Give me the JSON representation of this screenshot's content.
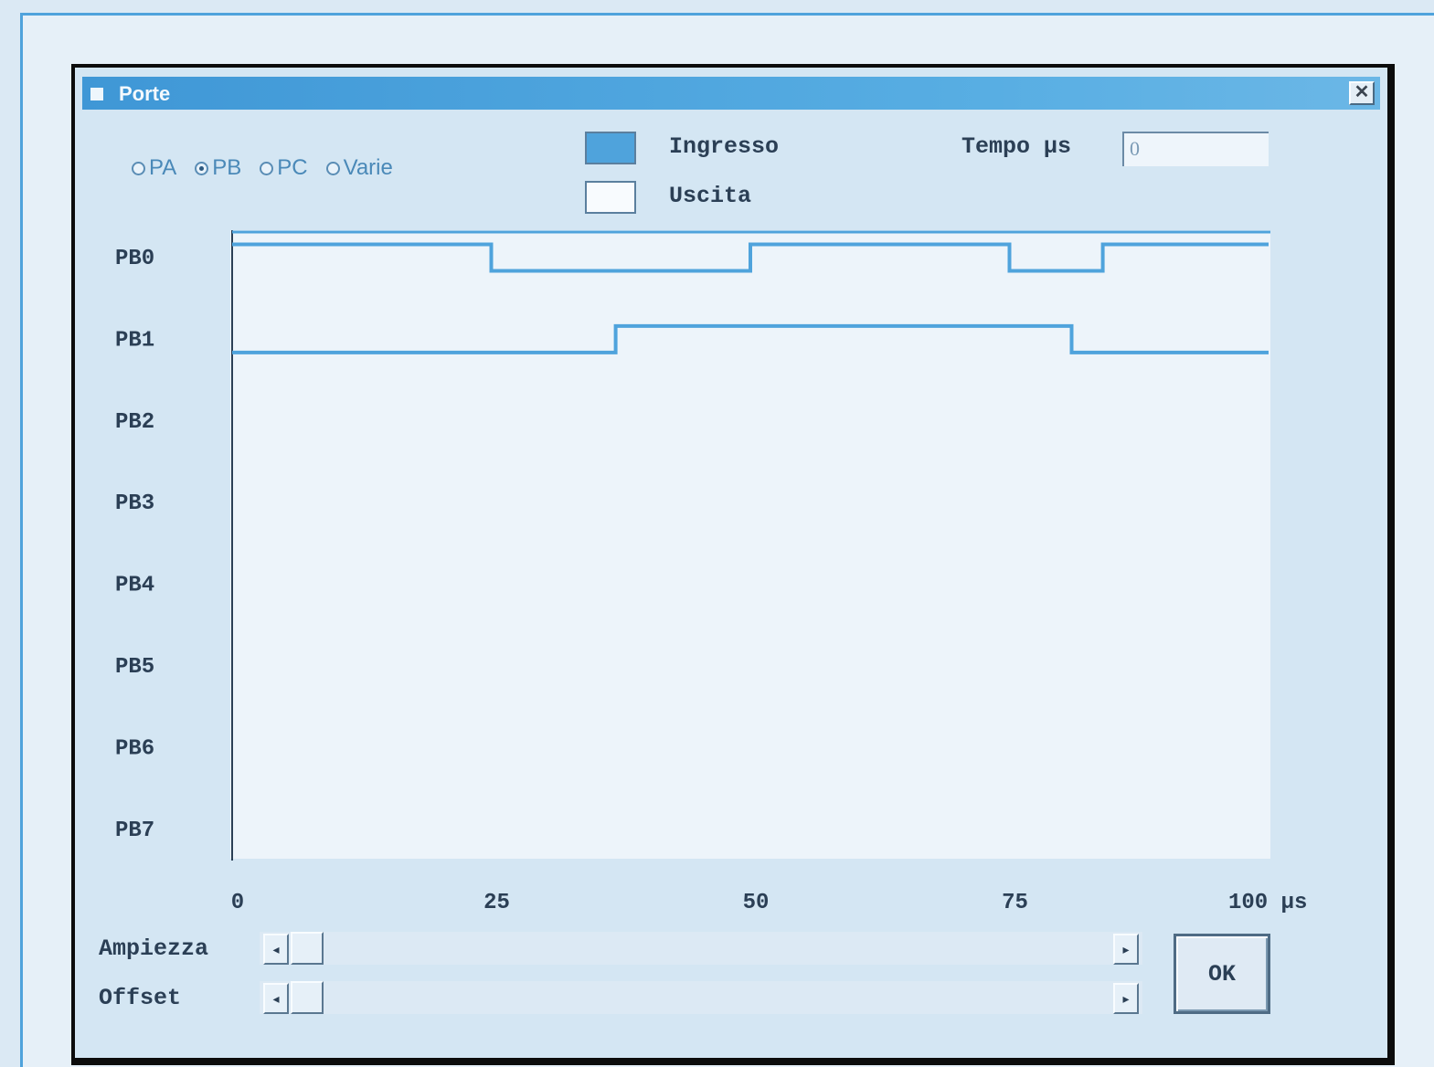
{
  "window": {
    "title": "Porte",
    "close_glyph": "✕"
  },
  "ports": [
    {
      "label": "PA",
      "selected": false
    },
    {
      "label": "PB",
      "selected": true
    },
    {
      "label": "PC",
      "selected": false
    },
    {
      "label": "Varie",
      "selected": false
    }
  ],
  "legend": {
    "input_label": "Ingresso",
    "output_label": "Uscita",
    "input_color": "#4fa3dc",
    "output_color": "#f8fbfe"
  },
  "tempo": {
    "label": "Tempo µs",
    "value": "0"
  },
  "chart_data": {
    "type": "line",
    "title": "",
    "xlabel": "",
    "ylabel": "",
    "xlim": [
      0,
      100
    ],
    "x_ticks": [
      "0",
      "25",
      "50",
      "75",
      "100 µs"
    ],
    "x_tick_values": [
      0,
      25,
      50,
      75,
      100
    ],
    "channels": [
      "PB0",
      "PB1",
      "PB2",
      "PB3",
      "PB4",
      "PB5",
      "PB6",
      "PB7"
    ],
    "series": [
      {
        "channel": "PB0",
        "x": [
          0,
          25,
          25,
          50,
          50,
          75,
          75,
          84,
          84,
          100
        ],
        "y": [
          1,
          1,
          0,
          0,
          1,
          1,
          0,
          0,
          1,
          1
        ]
      },
      {
        "channel": "PB1",
        "x": [
          0,
          37,
          37,
          81,
          81,
          100
        ],
        "y": [
          0,
          0,
          1,
          1,
          0,
          0
        ]
      }
    ],
    "line_color": "#4fa3dc",
    "grid": false
  },
  "controls": {
    "amplitude_label": "Ampiezza",
    "offset_label": "Offset",
    "ok_label": "OK",
    "arrow_left": "◂",
    "arrow_right": "▸"
  }
}
